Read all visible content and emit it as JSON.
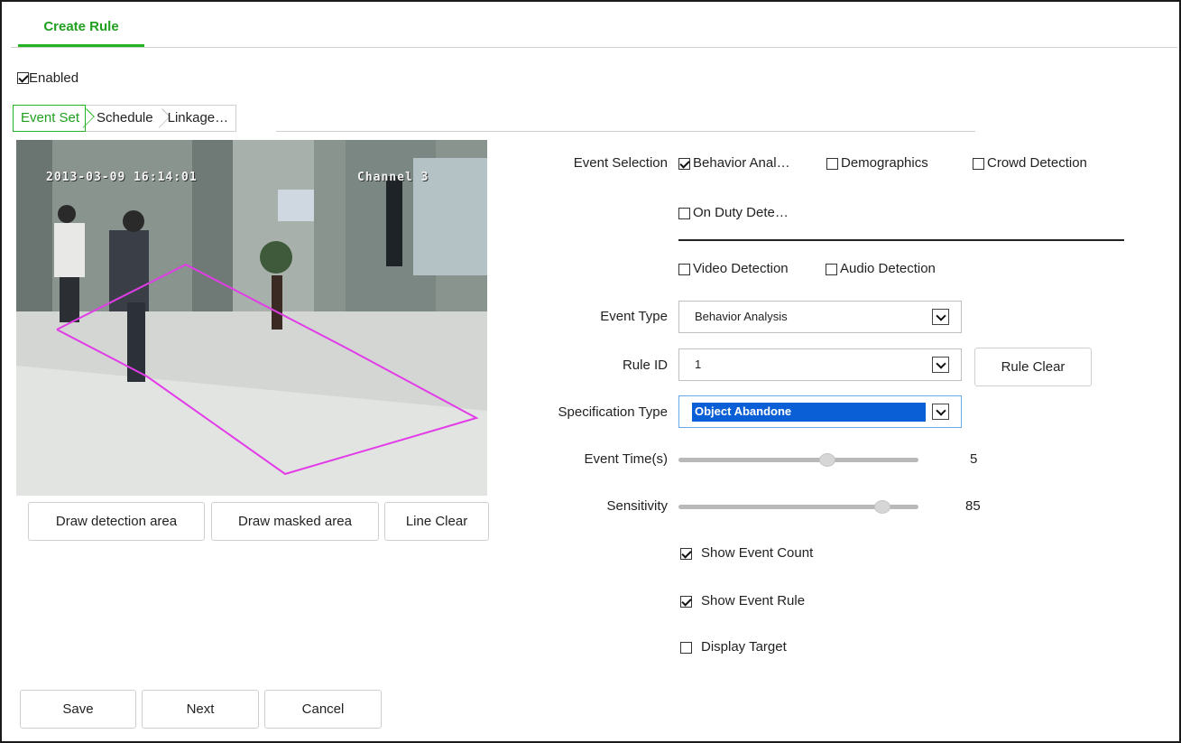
{
  "page_tab": "Create Rule",
  "enabled": {
    "label": "Enabled",
    "checked": true
  },
  "steps": [
    "Event Set",
    "Schedule",
    "Linkage…"
  ],
  "video": {
    "timestamp": "2013-03-09 16:14:01",
    "channel": "Channel 3"
  },
  "video_buttons": {
    "draw_detection": "Draw detection area",
    "draw_masked": "Draw masked area",
    "line_clear": "Line Clear"
  },
  "event_selection": {
    "label": "Event Selection",
    "options": [
      {
        "label": "Behavior Anal…",
        "checked": true
      },
      {
        "label": "Demographics",
        "checked": false
      },
      {
        "label": "Crowd Detection",
        "checked": false
      },
      {
        "label": "On Duty Dete…",
        "checked": false
      }
    ],
    "extra_options": [
      {
        "label": "Video Detection",
        "checked": false
      },
      {
        "label": "Audio Detection",
        "checked": false
      }
    ]
  },
  "event_type": {
    "label": "Event Type",
    "value": "Behavior Analysis"
  },
  "rule_id": {
    "label": "Rule ID",
    "value": "1",
    "clear_button": "Rule Clear"
  },
  "spec_type": {
    "label": "Specification Type",
    "value": "Object Abandone"
  },
  "event_time": {
    "label": "Event Time(s)",
    "value": "5",
    "fraction": 0.62
  },
  "sensitivity": {
    "label": "Sensitivity",
    "value": "85",
    "fraction": 0.85
  },
  "options": [
    {
      "label": "Show Event Count",
      "checked": true
    },
    {
      "label": "Show Event Rule",
      "checked": true
    },
    {
      "label": "Display Target",
      "checked": false
    }
  ],
  "footer": {
    "save": "Save",
    "next": "Next",
    "cancel": "Cancel"
  },
  "colors": {
    "accent": "#22b422",
    "selection": "#0a5fd6",
    "detection_area": "#e23ce8"
  }
}
